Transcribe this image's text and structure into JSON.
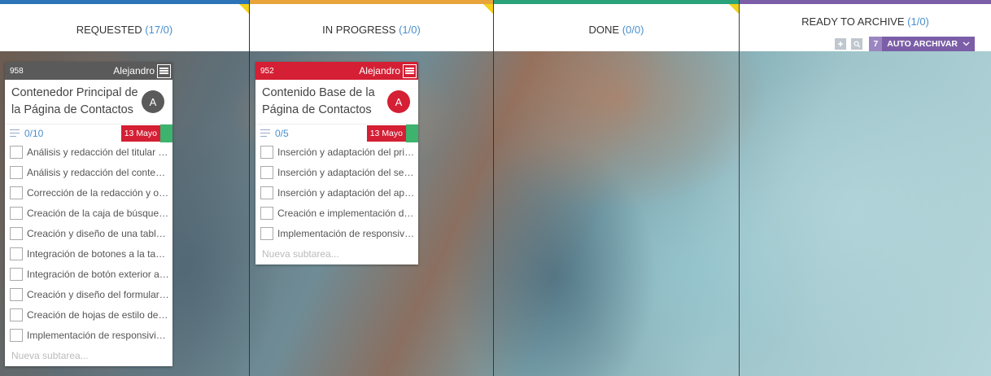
{
  "colors": {
    "requested": "#2b74b8",
    "in_progress": "#e8a43a",
    "done": "#2aa37a",
    "ready_to_archive": "#7b5ea7",
    "card_dark": "#5a5a5a",
    "card_red": "#d41f34"
  },
  "columns": [
    {
      "title": "REQUESTED",
      "count": "(17/0)"
    },
    {
      "title": "IN PROGRESS",
      "count": "(1/0)"
    },
    {
      "title": "DONE",
      "count": "(0/0)"
    },
    {
      "title": "READY TO ARCHIVE",
      "count": "(1/0)"
    }
  ],
  "archive_tools": {
    "auto_count": "7",
    "auto_label": "AUTO ARCHIVAR",
    "chevron_icon": "chevron-down-icon",
    "add_icon": "plus-icon",
    "search_icon": "search-icon"
  },
  "cards": [
    {
      "id": "958",
      "assignee": "Alejandro",
      "title": "Contenedor Principal de la Página de Contactos",
      "avatar": "A",
      "progress": "0/10",
      "due": "13 Mayo",
      "subtasks": [
        "Análisis y redacción del titular de la página",
        "Análisis y redacción del contenido de la página",
        "Corrección de la redacción y ortografía",
        "Creación de la caja de búsqueda",
        "Creación y diseño de una tabla de contactos",
        "Integración de botones a la tabla de contactos",
        "Integración de botón exterior a la tabla",
        "Creación y diseño del formulario de contacto",
        "Creación de hojas de estilo del contenedor",
        "Implementación de responsividad"
      ],
      "new_subtask_placeholder": "Nueva subtarea..."
    },
    {
      "id": "952",
      "assignee": "Alejandro",
      "title": "Contenido Base de la Página de Contactos",
      "avatar": "A",
      "progress": "0/5",
      "due": "13 Mayo",
      "subtasks": [
        "Inserción y adaptación del primer bloque",
        "Inserción y adaptación del segundo bloque",
        "Inserción y adaptación del apartado final",
        "Creación e implementación de estilos",
        "Implementación de responsividad"
      ],
      "new_subtask_placeholder": "Nueva subtarea..."
    }
  ]
}
